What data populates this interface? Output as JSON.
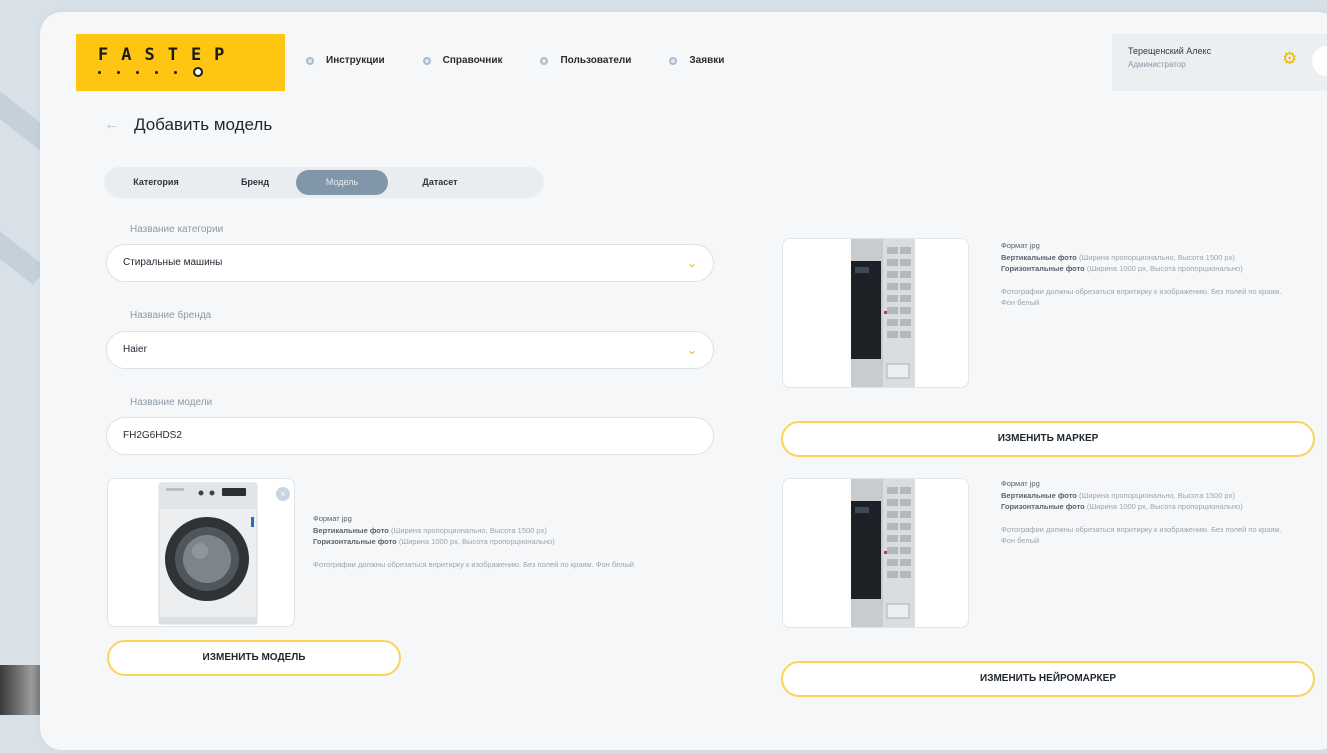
{
  "logo": {
    "text": "FASTEP"
  },
  "nav": [
    {
      "label": "Инструкции"
    },
    {
      "label": "Справочник"
    },
    {
      "label": "Пользователи"
    },
    {
      "label": "Заявки"
    }
  ],
  "user": {
    "name": "Терещенский Алекс",
    "role": "Администратор"
  },
  "page": {
    "title": "Добавить модель"
  },
  "tabs": [
    {
      "label": "Категория"
    },
    {
      "label": "Бренд"
    },
    {
      "label": "Модель"
    },
    {
      "label": "Датасет"
    }
  ],
  "form": {
    "category_label": "Название категории",
    "category_value": "Стиральные машины",
    "brand_label": "Название бренда",
    "brand_value": "Haier",
    "model_label": "Название модели",
    "model_value": "FH2G6HDS2"
  },
  "model_photo": {
    "format": "Формат jpg",
    "vertical_label": "Вертикальные фото",
    "vertical_text": "(Ширина пропорционально, Высота 1500 px)",
    "horizontal_label": "Горизонтальные фото",
    "horizontal_text": "(Ширина 1000 px, Высота пропорционально)",
    "note": "Фотографии должны обрезаться впритирку к изображению. Без полей по краям. Фон белый",
    "button": "ИЗМЕНИТЬ МОДЕЛЬ"
  },
  "marker_photo": {
    "format": "Формат jpg",
    "vertical_label": "Вертикальные фото",
    "vertical_text": "(Ширина пропорционально, Высота 1500 px)",
    "horizontal_label": "Горизонтальные фото",
    "horizontal_text": "(Ширина 1000 px, Высота пропорционально)",
    "note": "Фотографии должны обрезаться впритирку к изображению. Без полей по краям. Фон белый",
    "button": "ИЗМЕНИТЬ МАРКЕР"
  },
  "neuromarker_photo": {
    "format": "Формат jpg",
    "vertical_label": "Вертикальные фото",
    "vertical_text": "(Ширина пропорционально, Высота 1500 px)",
    "horizontal_label": "Горизонтальные фото",
    "horizontal_text": "(Ширина 1000 px, Высота пропорционально)",
    "note": "Фотографии должны обрезаться впритирку к изображению. Без полей по краям. Фон белый",
    "button": "ИЗМЕНИТЬ НЕЙРОМАРКЕР"
  },
  "colors": {
    "accent": "#fec512",
    "active_tab": "#8196a8",
    "button_border": "#fcd25a"
  },
  "icons": {
    "back": "arrow-left-icon",
    "chevron": "chevron-down-icon",
    "gear": "gear-icon",
    "close": "close-icon"
  }
}
